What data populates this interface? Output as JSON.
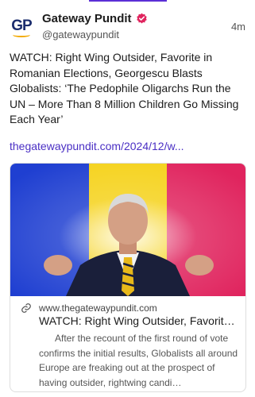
{
  "author": {
    "avatar_text": "GP",
    "display_name": "Gateway Pundit",
    "handle": "@gatewaypundit",
    "verified_icon": "verified-check-icon",
    "time_ago": "4m"
  },
  "post": {
    "text": "WATCH: Right Wing Outsider, Favorite in Romanian Elections, Georgescu Blasts Globalists: ‘The Pedophile Oligarchs Run the UN – More Than 8 Million Children Go Missing Each Year’",
    "link": "thegatewaypundit.com/2024/12/w..."
  },
  "link_card": {
    "url": "www.thegatewaypundit.com",
    "url_icon": "link-icon",
    "title": "WATCH: Right Wing Outsider, Favorite…",
    "description": "After the recount of the first round of vote confirms the initial results, Globalists all around Europe are freaking out at the prospect of having outsider, rightwing candi…"
  },
  "colors": {
    "accent": "#4a2fc4",
    "flag_blue": "#1f3fd1",
    "flag_yellow": "#f5d21a",
    "flag_red": "#e0245e",
    "verified": "#e0245e"
  }
}
